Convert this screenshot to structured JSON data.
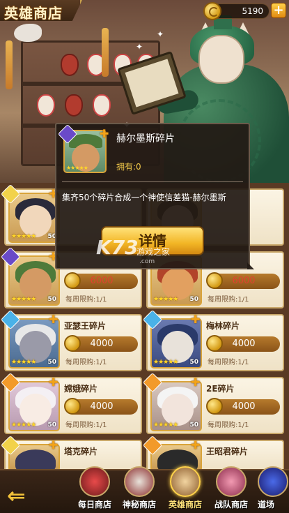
{
  "header": {
    "title": "英雄商店",
    "currency_value": "5190",
    "currency_icon": "gold-coin-icon",
    "add_label": "+"
  },
  "items": [
    {
      "name": "",
      "price": "",
      "price_color": "white",
      "limit": "",
      "stars": "★★★★★",
      "level": "50"
    },
    {
      "name": "",
      "price": "",
      "price_color": "red",
      "limit": "",
      "stars": "★★★★★",
      "level": "50"
    },
    {
      "name": "",
      "price": "6000",
      "price_color": "red",
      "limit": "每周限购:1/1",
      "stars": "★★★★★",
      "level": "50"
    },
    {
      "name": "",
      "price": "6000",
      "price_color": "red",
      "limit": "每周限购:1/1",
      "stars": "★★★★★",
      "level": "50"
    },
    {
      "name": "亚瑟王碎片",
      "price": "4000",
      "price_color": "white",
      "limit": "每周限购:1/1",
      "stars": "★★★★★",
      "level": "50"
    },
    {
      "name": "梅林碎片",
      "price": "4000",
      "price_color": "white",
      "limit": "每周限购:1/1",
      "stars": "★★★★★",
      "level": "50"
    },
    {
      "name": "嫦娥碎片",
      "price": "4000",
      "price_color": "white",
      "limit": "每周限购:1/1",
      "stars": "★★★★★",
      "level": "50"
    },
    {
      "name": "2E碎片",
      "price": "4000",
      "price_color": "white",
      "limit": "每周限购:1/1",
      "stars": "★★★★★",
      "level": "50"
    },
    {
      "name": "塔克碎片",
      "price": "",
      "price_color": "white",
      "limit": "",
      "stars": "★★★★★",
      "level": ""
    },
    {
      "name": "王昭君碎片",
      "price": "",
      "price_color": "white",
      "limit": "",
      "stars": "★★★★★",
      "level": ""
    }
  ],
  "tooltip": {
    "name": "赫尔墨斯碎片",
    "owned": "拥有:0",
    "stars": "★★★★★",
    "description": "集齐50个碎片合成一个神使信差猫-赫尔墨斯",
    "detail_button": "详情"
  },
  "watermark": {
    "logo": "K73",
    "sub": "游戏之家",
    "url": ".com"
  },
  "nav": {
    "back_icon": "back-arrow-icon",
    "tabs": [
      {
        "label": "每日商店",
        "icon": "daily-shop-icon"
      },
      {
        "label": "神秘商店",
        "icon": "mystery-shop-icon"
      },
      {
        "label": "英雄商店",
        "icon": "hero-shop-icon",
        "active": true
      },
      {
        "label": "战队商店",
        "icon": "team-shop-icon"
      },
      {
        "label": "道场",
        "icon": "dojo-shop-icon"
      }
    ]
  },
  "colors": {
    "accent_gold": "#f2b525",
    "price_red": "#e0412e",
    "card_bg": "#fbf4e4"
  }
}
